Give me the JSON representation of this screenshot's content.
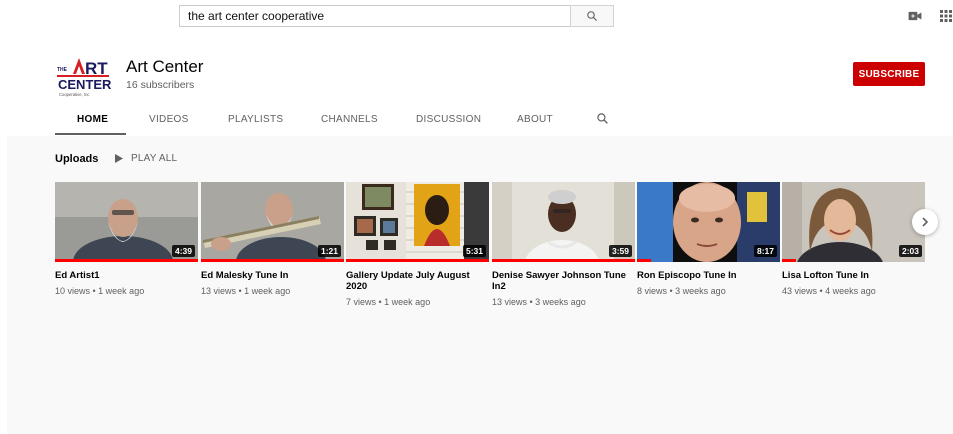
{
  "search": {
    "value": "the art center cooperative",
    "button_icon": "search-icon"
  },
  "topbar": {
    "icons": [
      "video-camera-icon",
      "apps-grid-icon"
    ]
  },
  "channel": {
    "logo_text": "THE ART CENTER Cooperative, Inc",
    "name": "Art Center",
    "subscribers": "16 subscribers",
    "subscribe_label": "SUBSCRIBE",
    "accent_color": "#cc0000"
  },
  "tabs": [
    {
      "label": "HOME",
      "active": true
    },
    {
      "label": "VIDEOS"
    },
    {
      "label": "PLAYLISTS"
    },
    {
      "label": "CHANNELS"
    },
    {
      "label": "DISCUSSION"
    },
    {
      "label": "ABOUT"
    }
  ],
  "uploads": {
    "title": "Uploads",
    "play_all_label": "PLAY ALL",
    "videos": [
      {
        "title": "Ed Artist1",
        "meta": "10 views • 1 week ago",
        "duration": "4:39",
        "watched": 1.0
      },
      {
        "title": "Ed Malesky Tune In",
        "meta": "13 views • 1 week ago",
        "duration": "1:21",
        "watched": 1.0
      },
      {
        "title": "Gallery Update July August 2020",
        "meta": "7 views • 1 week ago",
        "duration": "5:31",
        "watched": 1.0
      },
      {
        "title": "Denise Sawyer Johnson Tune In2",
        "meta": "13 views • 3 weeks ago",
        "duration": "3:59",
        "watched": 1.0
      },
      {
        "title": "Ron Episcopo Tune In",
        "meta": "8 views • 3 weeks ago",
        "duration": "8:17",
        "watched": 0.1
      },
      {
        "title": "Lisa Lofton Tune In",
        "meta": "43 views • 4 weeks ago",
        "duration": "2:03",
        "watched": 0.1
      }
    ]
  }
}
